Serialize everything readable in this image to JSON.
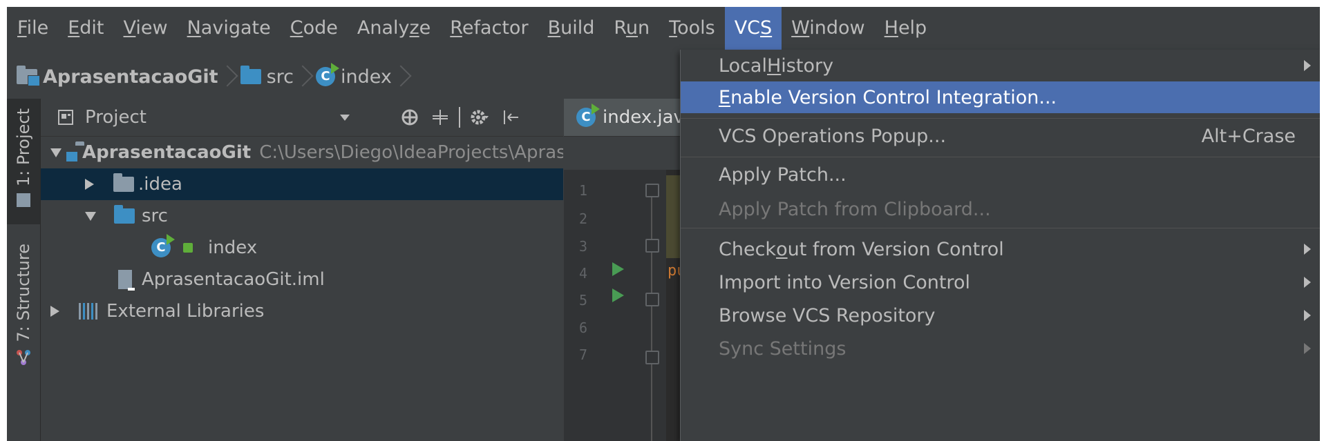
{
  "menubar": {
    "items": [
      {
        "pre": "",
        "ul": "F",
        "post": "ile"
      },
      {
        "pre": "",
        "ul": "E",
        "post": "dit"
      },
      {
        "pre": "",
        "ul": "V",
        "post": "iew"
      },
      {
        "pre": "",
        "ul": "N",
        "post": "avigate"
      },
      {
        "pre": "",
        "ul": "C",
        "post": "ode"
      },
      {
        "pre": "Analy",
        "ul": "z",
        "post": "e"
      },
      {
        "pre": "",
        "ul": "R",
        "post": "efactor"
      },
      {
        "pre": "",
        "ul": "B",
        "post": "uild"
      },
      {
        "pre": "R",
        "ul": "u",
        "post": "n"
      },
      {
        "pre": "",
        "ul": "T",
        "post": "ools"
      },
      {
        "pre": "VC",
        "ul": "S",
        "post": ""
      },
      {
        "pre": "",
        "ul": "W",
        "post": "indow"
      },
      {
        "pre": "",
        "ul": "H",
        "post": "elp"
      }
    ]
  },
  "breadcrumb": {
    "project": "AprasentacaoGit",
    "folder": "src",
    "file": "index"
  },
  "tool_stripe": {
    "project_label": "1: Project",
    "structure_label": "7: Structure"
  },
  "project_panel": {
    "title": "Project",
    "tree": {
      "root_name": "AprasentacaoGit",
      "root_path": "C:\\Users\\Diego\\IdeaProjects\\Aprase",
      "idea": ".idea",
      "src": "src",
      "index": "index",
      "iml": "AprasentacaoGit.iml",
      "libs": "External Libraries"
    }
  },
  "editor": {
    "tab_label": "index.jav",
    "line_numbers": [
      "1",
      "2",
      "3",
      "4",
      "5",
      "6",
      "7"
    ],
    "code_keyword": "pu"
  },
  "vcs_menu": {
    "local_history": {
      "pre": "Local ",
      "ul": "H",
      "post": "istory"
    },
    "enable_vci": {
      "pre": "",
      "ul": "E",
      "post": "nable Version Control Integration..."
    },
    "ops_popup": "VCS Operations Popup...",
    "ops_shortcut": "Alt+Crase",
    "apply_patch": "Apply Patch...",
    "apply_patch_clipboard": "Apply Patch from Clipboard...",
    "checkout": {
      "pre": "Check",
      "ul": "o",
      "post": "ut from Version Control"
    },
    "import": "Import into Version Control",
    "browse": "Browse VCS Repository",
    "sync": "Sync Settings"
  },
  "colors": {
    "background": "#3c3f41",
    "highlight": "#4b6eaf",
    "selection": "#0d293e",
    "editor_bg": "#2b2b2b"
  }
}
